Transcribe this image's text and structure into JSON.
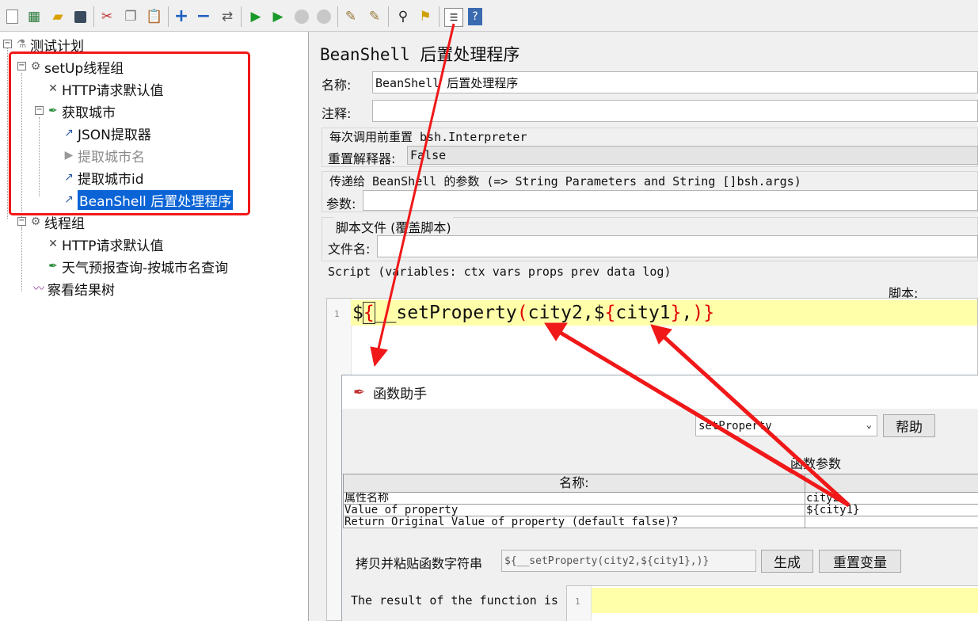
{
  "toolbar": {
    "icons": [
      "new-icon",
      "templates-icon",
      "open-icon",
      "save-icon",
      "cut-icon",
      "copy-icon",
      "paste-icon",
      "expand-icon",
      "collapse-icon",
      "toggle-icon",
      "start-icon",
      "start-no-pause-icon",
      "stop-icon",
      "shutdown-icon",
      "clear-icon",
      "clear-all-icon",
      "search-icon",
      "reset-search-icon",
      "function-helper-icon",
      "help-icon"
    ]
  },
  "tree": {
    "root": "测试计划",
    "setup_group": "setUp线程组",
    "setup_http_defaults": "HTTP请求默认值",
    "get_city": "获取城市",
    "json_extractor": "JSON提取器",
    "extract_city_name": "提取城市名",
    "extract_city_id": "提取城市id",
    "beanshell_post": "BeanShell 后置处理程序",
    "thread_group": "线程组",
    "thread_http_defaults": "HTTP请求默认值",
    "weather_query": "天气预报查询-按城市名查询",
    "view_results_tree": "察看结果树"
  },
  "panel": {
    "title": "BeanShell 后置处理程序",
    "name_label": "名称:",
    "name_value": "BeanShell 后置处理程序",
    "comment_label": "注释:",
    "comment_value": "",
    "reset_section": "每次调用前重置 bsh.Interpreter",
    "reset_label": "重置解释器:",
    "reset_value": "False",
    "params_section": "传递给 BeanShell 的参数 (=> String Parameters and String []bsh.args)",
    "params_label": "参数:",
    "params_value": "",
    "file_section": "脚本文件 (覆盖脚本)",
    "file_label": "文件名:",
    "file_value": "",
    "script_label": "Script (variables: ctx vars props prev data log)",
    "script_caption": "脚本:",
    "line_number": "1",
    "script_tokens": {
      "dollar1": "$",
      "brace1": "{",
      "func": "__setProperty",
      "paren1": "(",
      "args1": "city2,",
      "dollar2": "$",
      "brace2": "{",
      "var": "city1",
      "brace3": "}",
      "comma": ",",
      "paren2": ")",
      "brace4": "}"
    }
  },
  "dialog": {
    "title": "函数助手",
    "function_select": "setProperty",
    "help_button": "帮助",
    "params_caption": "函数参数",
    "table_header": "名称:",
    "rows": [
      {
        "name": "属性名称",
        "value": "city2"
      },
      {
        "name": "Value of property",
        "value": "${city1}"
      },
      {
        "name": "Return Original Value of property (default false)?",
        "value": ""
      }
    ],
    "copy_label": "拷贝并粘贴函数字符串",
    "function_string": "${__setProperty(city2,${city1},)}",
    "generate_button": "生成",
    "reset_vars_button": "重置变量",
    "result_label": "The result of the function is",
    "result_line_number": "1",
    "result_value": ""
  },
  "colors": {
    "annotation_red": "#f01818",
    "selection_blue": "#0a64d6",
    "editor_highlight": "#ffffaa",
    "brace_red": "#e00000"
  }
}
